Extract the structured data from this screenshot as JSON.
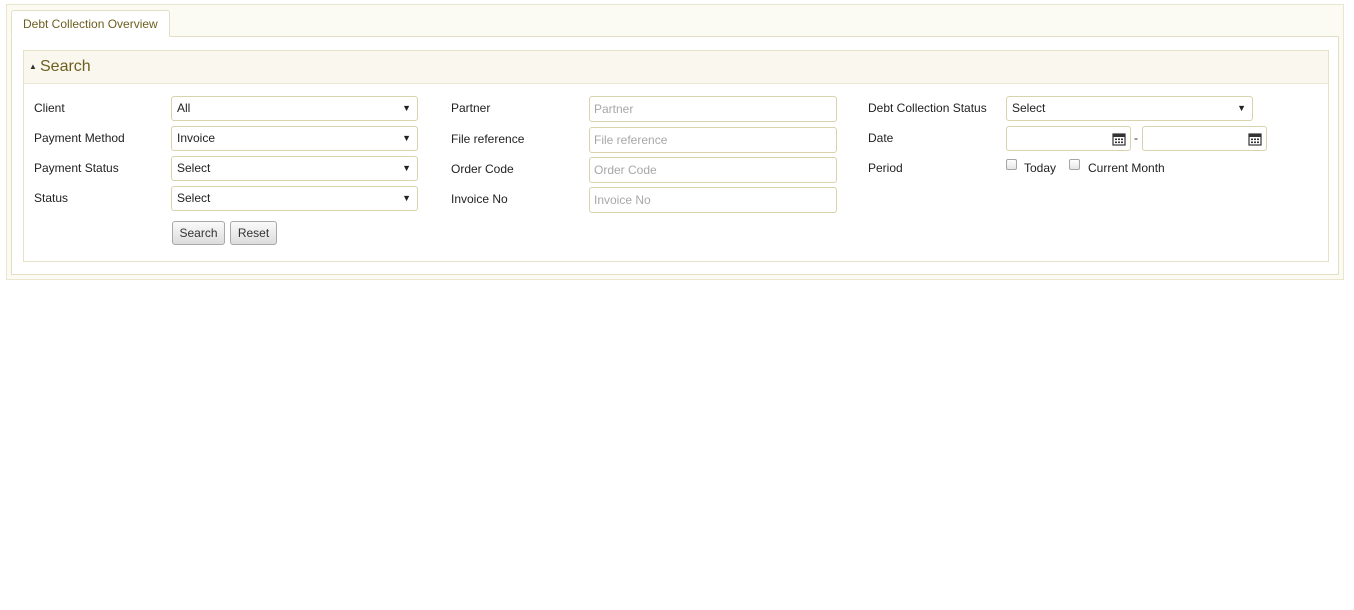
{
  "tab": {
    "label": "Debt Collection Overview"
  },
  "search_panel": {
    "title": "Search",
    "fields": {
      "client": {
        "label": "Client",
        "value": "All"
      },
      "payment_method": {
        "label": "Payment Method",
        "value": "Invoice"
      },
      "payment_status": {
        "label": "Payment Status",
        "value": "Select"
      },
      "status": {
        "label": "Status",
        "value": "Select"
      },
      "partner": {
        "label": "Partner",
        "placeholder": "Partner"
      },
      "file_reference": {
        "label": "File reference",
        "placeholder": "File reference"
      },
      "order_code": {
        "label": "Order Code",
        "placeholder": "Order Code"
      },
      "invoice_no": {
        "label": "Invoice No",
        "placeholder": "Invoice No"
      },
      "debt_collection_status": {
        "label": "Debt Collection Status",
        "value": "Select"
      },
      "date": {
        "label": "Date",
        "separator": "-"
      },
      "period": {
        "label": "Period",
        "options": [
          "Today",
          "Current Month"
        ]
      }
    },
    "buttons": {
      "search": "Search",
      "reset": "Reset"
    }
  },
  "colors": {
    "accent_text": "#6d5e1e",
    "border": "#d8d2ad",
    "panel_bg": "#faf8ee"
  }
}
